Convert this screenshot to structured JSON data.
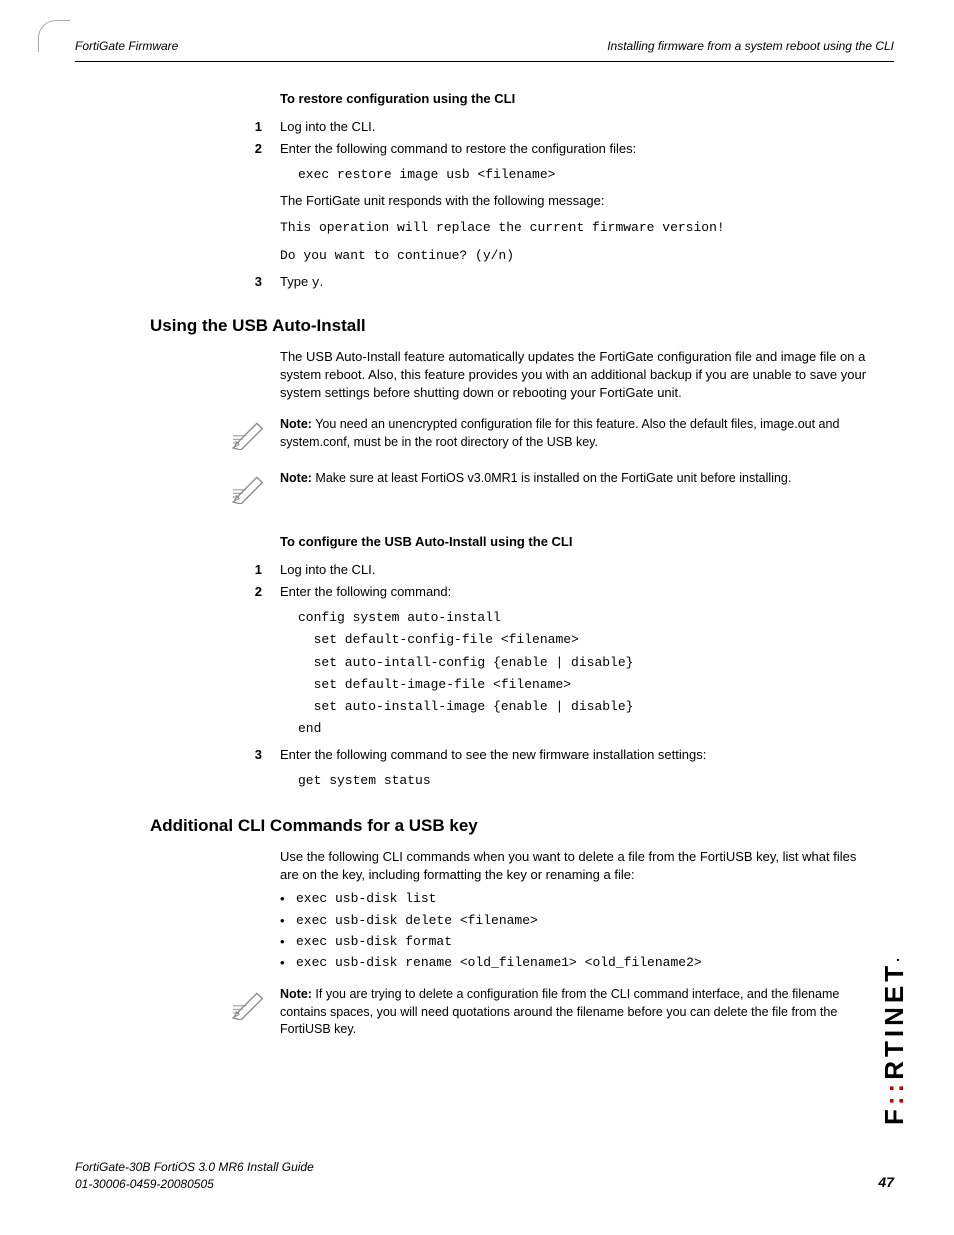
{
  "header": {
    "left": "FortiGate Firmware",
    "right": "Installing firmware from a system reboot using the CLI"
  },
  "sec1": {
    "subheading": "To restore configuration using the CLI",
    "step1_num": "1",
    "step1_text": "Log into the CLI.",
    "step2_num": "2",
    "step2_text": "Enter the following command to restore the configuration files:",
    "code1": "exec restore image usb <filename>",
    "resp_intro": "The FortiGate unit responds with the following message:",
    "resp1": "This operation will replace the current firmware version!",
    "resp2": "Do you want to continue? (y/n)",
    "step3_num": "3",
    "step3_pre": "Type ",
    "step3_code": "y",
    "step3_post": "."
  },
  "sec2": {
    "heading": "Using the USB Auto-Install",
    "para1": "The USB Auto-Install feature automatically updates the FortiGate configuration file and image file on a system reboot. Also, this feature provides you with an additional backup if you are unable to save your system settings before shutting down or rebooting your FortiGate unit.",
    "note1_label": "Note:",
    "note1_text": " You need an unencrypted configuration file for this feature. Also the default files, image.out and system.conf, must be in the root directory of the USB key.",
    "note2_label": "Note:",
    "note2_text": " Make sure at least FortiOS v3.0MR1 is installed on the FortiGate unit before installing.",
    "subheading": "To configure the USB Auto-Install using the CLI",
    "step1_num": "1",
    "step1_text": "Log into the CLI.",
    "step2_num": "2",
    "step2_text": "Enter the following command:",
    "code_block": "config system auto-install\n  set default-config-file <filename>\n  set auto-intall-config {enable | disable}\n  set default-image-file <filename>\n  set auto-install-image {enable | disable}\nend",
    "step3_num": "3",
    "step3_text": "Enter the following command to see the new firmware installation settings:",
    "code3": "get system status"
  },
  "sec3": {
    "heading": "Additional CLI Commands for a USB key",
    "para1": "Use the following CLI commands when you want to delete a file from the FortiUSB key, list what files are on the key, including formatting the key or renaming a file:",
    "bullets": [
      "exec usb-disk list",
      "exec usb-disk delete <filename>",
      "exec usb-disk format",
      "exec usb-disk rename <old_filename1> <old_filename2>"
    ],
    "note_label": "Note:",
    "note_text": " If you are trying to delete a configuration file from the CLI command interface, and the filename contains spaces, you will need quotations around the filename before you can delete the file from the FortiUSB key."
  },
  "footer": {
    "line1": "FortiGate-30B FortiOS 3.0 MR6 Install Guide",
    "line2": "01-30006-0459-20080505",
    "page": "47"
  },
  "logo": "F   RTINET"
}
